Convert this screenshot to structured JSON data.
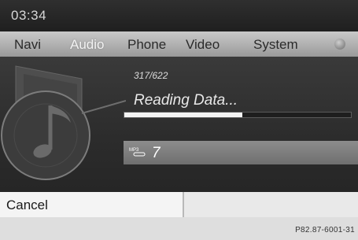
{
  "status_bar": {
    "clock": "03:34"
  },
  "menu": {
    "items": [
      {
        "label": "Navi",
        "selected": false
      },
      {
        "label": "Audio",
        "selected": true
      },
      {
        "label": "Phone",
        "selected": false
      },
      {
        "label": "Video",
        "selected": false
      },
      {
        "label": "System",
        "selected": false
      }
    ],
    "options_icon": "round-menu-dot-icon"
  },
  "content": {
    "track_count": "317/622",
    "status_text": "Reading Data...",
    "progress_fraction": 0.52,
    "track_icon": "mp3-icon",
    "track_number": "7",
    "graphic_icon": "music-note-cd-icon"
  },
  "bottom_bar": {
    "cancel_label": "Cancel"
  },
  "footer": {
    "figure_code": "P82.87-6001-31"
  },
  "colors": {
    "progress_fill": "#f4f4f4",
    "menu_bar": "#b0b0b0",
    "background": "#2b2b2b"
  }
}
